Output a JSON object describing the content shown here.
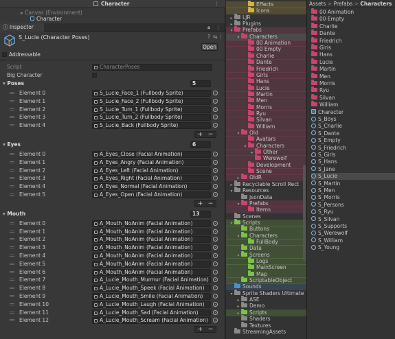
{
  "colors": {
    "pink": "#c8466e",
    "green": "#7bc24a",
    "yellow": "#d9b23a",
    "blue": "#4a8fd6",
    "grey": "#8a8a8a"
  },
  "hierarchy": {
    "title": "Character",
    "rows": [
      "Canvas (Environment)",
      "Character"
    ]
  },
  "inspector": {
    "tab": "Inspector",
    "object_name": "S_Lucie (Character Poses)",
    "open_button": "Open",
    "addressable_label": "Addressable",
    "script_label": "Script",
    "script_value": "CharacterPoses",
    "big_label": "Big Character",
    "sections": [
      {
        "name": "Poses",
        "count": "5",
        "items": [
          "S_Lucie_Face_1 (Fullbody Sprite)",
          "S_Lucie_Face_2 (Fullbody Sprite)",
          "S_Lucie_Turn_1 (Fullbody Sprite)",
          "S_Lucie_Turn_2 (Fullbody Sprite)",
          "S_Lucie_Back (Fullbody Sprite)"
        ]
      },
      {
        "name": "Eyes",
        "count": "6",
        "items": [
          "A_Eyes_Close (Facial Animation)",
          "A_Eyes_Angry (Facial Animation)",
          "A_Eyes_Left (Facial Animation)",
          "A_Eyes_Right (Facial Animation)",
          "A_Eyes_Normal (Facial Animation)",
          "A_Eyes_Open (Facial Animation)"
        ]
      },
      {
        "name": "Mouth",
        "count": "13",
        "items": [
          "A_Mouth_NoAnim (Facial Animation)",
          "A_Mouth_NoAnim (Facial Animation)",
          "A_Mouth_NoAnim (Facial Animation)",
          "A_Mouth_NoAnim (Facial Animation)",
          "A_Mouth_NoAnim (Facial Animation)",
          "A_Mouth_NoAnim (Facial Animation)",
          "A_Mouth_NoAnim (Facial Animation)",
          "A_Lucie_Mouth_Murmur (Facial Animation)",
          "A_Lucie_Mouth_Speek (Facial Animation)",
          "A_Lucie_Mouth_Smile (Facial Animation)",
          "A_Lucie_Mouth_Laugh (Facial Animation)",
          "A_Lucie_Mouth_Sad (Facial Animation)",
          "A_Lucie_Mouth_Scream (Facial Animation)"
        ]
      }
    ]
  },
  "project_tree": [
    {
      "label": "Effects",
      "c": "yellow",
      "ind": 3,
      "arrow": false
    },
    {
      "label": "Icons",
      "c": "yellow",
      "ind": 3,
      "arrow": false
    },
    {
      "label": "LJR",
      "c": "grey",
      "ind": 1,
      "arrow": true
    },
    {
      "label": "Plugins",
      "c": "grey",
      "ind": 1,
      "arrow": true
    },
    {
      "label": "Prefabs",
      "c": "pink",
      "ind": 1,
      "arrow": true,
      "open": true
    },
    {
      "label": "Characters",
      "c": "pink",
      "ind": 2,
      "arrow": true,
      "open": true,
      "sel": true
    },
    {
      "label": "00 Animation",
      "c": "pink",
      "ind": 3,
      "arrow": false
    },
    {
      "label": "00 Empty",
      "c": "pink",
      "ind": 3,
      "arrow": false
    },
    {
      "label": "Charlie",
      "c": "pink",
      "ind": 3,
      "arrow": false
    },
    {
      "label": "Dante",
      "c": "pink",
      "ind": 3,
      "arrow": false
    },
    {
      "label": "Friedrich",
      "c": "pink",
      "ind": 3,
      "arrow": false
    },
    {
      "label": "Girls",
      "c": "pink",
      "ind": 3,
      "arrow": false
    },
    {
      "label": "Hans",
      "c": "pink",
      "ind": 3,
      "arrow": false
    },
    {
      "label": "Lucie",
      "c": "pink",
      "ind": 3,
      "arrow": false
    },
    {
      "label": "Martin",
      "c": "pink",
      "ind": 3,
      "arrow": false
    },
    {
      "label": "Men",
      "c": "pink",
      "ind": 3,
      "arrow": false
    },
    {
      "label": "Morris",
      "c": "pink",
      "ind": 3,
      "arrow": false
    },
    {
      "label": "Ryu",
      "c": "pink",
      "ind": 3,
      "arrow": false
    },
    {
      "label": "Silvan",
      "c": "pink",
      "ind": 3,
      "arrow": false
    },
    {
      "label": "William",
      "c": "pink",
      "ind": 3,
      "arrow": false
    },
    {
      "label": "Old",
      "c": "pink",
      "ind": 2,
      "arrow": true,
      "open": true
    },
    {
      "label": "Avatars",
      "c": "pink",
      "ind": 3,
      "arrow": false
    },
    {
      "label": "Characters",
      "c": "pink",
      "ind": 3,
      "arrow": true,
      "open": true
    },
    {
      "label": "Other",
      "c": "pink",
      "ind": 4,
      "arrow": true
    },
    {
      "label": "Werewolf",
      "c": "pink",
      "ind": 4,
      "arrow": false
    },
    {
      "label": "Development",
      "c": "pink",
      "ind": 3,
      "arrow": false
    },
    {
      "label": "Scene",
      "c": "pink",
      "ind": 3,
      "arrow": false
    },
    {
      "label": "OldR",
      "c": "pink",
      "ind": 2,
      "arrow": true
    },
    {
      "label": "Recyclable Scroll Rect",
      "c": "grey",
      "ind": 1,
      "arrow": true
    },
    {
      "label": "Resources",
      "c": "grey",
      "ind": 1,
      "arrow": true,
      "open": true
    },
    {
      "label": "JsonData",
      "c": "grey",
      "ind": 2,
      "arrow": false
    },
    {
      "label": "Prefabs",
      "c": "pink",
      "ind": 2,
      "arrow": true,
      "open": true
    },
    {
      "label": "Items",
      "c": "pink",
      "ind": 3,
      "arrow": false
    },
    {
      "label": "Scenes",
      "c": "grey",
      "ind": 1,
      "arrow": false
    },
    {
      "label": "Scripts",
      "c": "green",
      "ind": 1,
      "arrow": true,
      "open": true
    },
    {
      "label": "Buttons",
      "c": "green",
      "ind": 2,
      "arrow": false
    },
    {
      "label": "Characters",
      "c": "green",
      "ind": 2,
      "arrow": true,
      "open": true
    },
    {
      "label": "FullBody",
      "c": "green",
      "ind": 3,
      "arrow": false
    },
    {
      "label": "Data",
      "c": "green",
      "ind": 2,
      "arrow": false
    },
    {
      "label": "Screens",
      "c": "green",
      "ind": 2,
      "arrow": true,
      "open": true
    },
    {
      "label": "Logs",
      "c": "green",
      "ind": 3,
      "arrow": false
    },
    {
      "label": "MainScreen",
      "c": "green",
      "ind": 3,
      "arrow": false
    },
    {
      "label": "Map",
      "c": "green",
      "ind": 3,
      "arrow": false
    },
    {
      "label": "ScriptableObject",
      "c": "green",
      "ind": 2,
      "arrow": false
    },
    {
      "label": "Sounds",
      "c": "blue",
      "ind": 1,
      "arrow": false
    },
    {
      "label": "Sprite Shaders Ultimate",
      "c": "grey",
      "ind": 1,
      "arrow": true,
      "open": true
    },
    {
      "label": "ASE",
      "c": "grey",
      "ind": 2,
      "arrow": true
    },
    {
      "label": "Demo",
      "c": "grey",
      "ind": 2,
      "arrow": true
    },
    {
      "label": "Scripts",
      "c": "green",
      "ind": 2,
      "arrow": true
    },
    {
      "label": "Shaders",
      "c": "grey",
      "ind": 2,
      "arrow": false
    },
    {
      "label": "Textures",
      "c": "grey",
      "ind": 2,
      "arrow": false
    },
    {
      "label": "StreamingAssets",
      "c": "grey",
      "ind": 1,
      "arrow": false
    }
  ],
  "breadcrumb": [
    "Assets",
    "Prefabs",
    "Characters"
  ],
  "grid_items": [
    {
      "label": "00 Animation",
      "t": "folder"
    },
    {
      "label": "00 Empty",
      "t": "folder"
    },
    {
      "label": "Charlie",
      "t": "folder"
    },
    {
      "label": "Dante",
      "t": "folder"
    },
    {
      "label": "Friedrich",
      "t": "folder"
    },
    {
      "label": "Girls",
      "t": "folder"
    },
    {
      "label": "Hans",
      "t": "folder"
    },
    {
      "label": "Lucie",
      "t": "folder"
    },
    {
      "label": "Martin",
      "t": "folder"
    },
    {
      "label": "Men",
      "t": "folder"
    },
    {
      "label": "Morris",
      "t": "folder"
    },
    {
      "label": "Ryu",
      "t": "folder"
    },
    {
      "label": "Silvan",
      "t": "folder"
    },
    {
      "label": "William",
      "t": "folder"
    },
    {
      "label": "Character",
      "t": "prefab"
    },
    {
      "label": "S_Boys",
      "t": "asset"
    },
    {
      "label": "S_Charlie",
      "t": "asset"
    },
    {
      "label": "S_Dante",
      "t": "asset"
    },
    {
      "label": "S_Empty",
      "t": "asset"
    },
    {
      "label": "S_Friedrich",
      "t": "asset"
    },
    {
      "label": "S_Girls",
      "t": "asset"
    },
    {
      "label": "S_Hans",
      "t": "asset"
    },
    {
      "label": "S_Jane",
      "t": "asset"
    },
    {
      "label": "S_Lucie",
      "t": "asset",
      "sel": true
    },
    {
      "label": "S_Martin",
      "t": "asset"
    },
    {
      "label": "S_Men",
      "t": "asset"
    },
    {
      "label": "S_Morris",
      "t": "asset"
    },
    {
      "label": "S_Persons",
      "t": "asset"
    },
    {
      "label": "S_Ryu",
      "t": "asset"
    },
    {
      "label": "S_Silvan",
      "t": "asset"
    },
    {
      "label": "S_Supports",
      "t": "asset"
    },
    {
      "label": "S_Werewolf",
      "t": "asset"
    },
    {
      "label": "S_William",
      "t": "asset"
    },
    {
      "label": "S_Young",
      "t": "asset"
    }
  ]
}
